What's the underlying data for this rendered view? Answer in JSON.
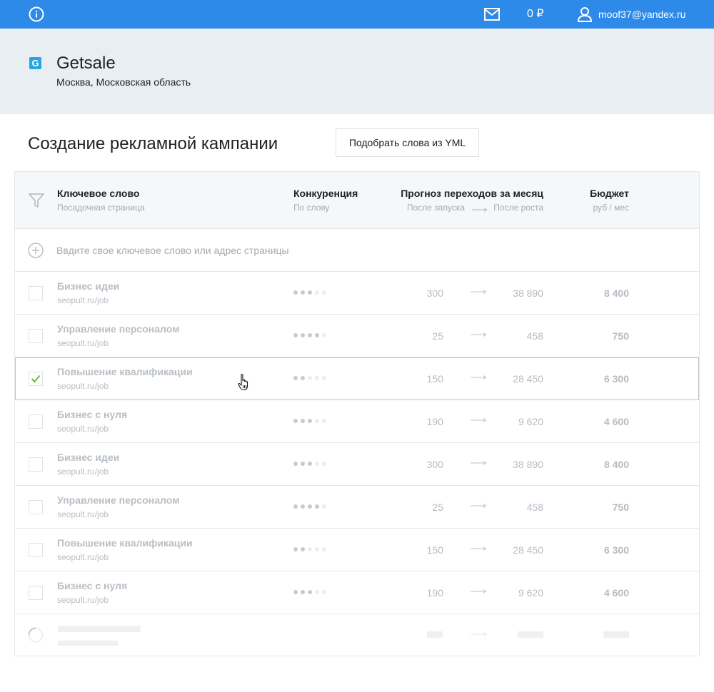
{
  "topbar": {
    "balance": "0 ₽",
    "email": "moof37@yandex.ru"
  },
  "company": {
    "logo_letter": "G",
    "name": "Getsale",
    "region": "Москва, Московская область"
  },
  "page": {
    "title": "Создание рекламной кампании",
    "yml_button": "Подобрать слова из YML"
  },
  "table": {
    "headers": {
      "keyword": "Ключевое слово",
      "keyword_sub": "Посадочная страница",
      "competition": "Конкуренция",
      "competition_sub": "По слову",
      "forecast": "Прогноз переходов за месяц",
      "forecast_start": "После запуска",
      "forecast_grow": "После роста",
      "budget": "Бюджет",
      "budget_sub": "руб / мес"
    },
    "add_placeholder": "Ввдите свое ключевое слово или адрес страницы",
    "rows": [
      {
        "keyword": "Бизнес идеи",
        "url": "seopult.ru/job",
        "competition": 3,
        "start": "300",
        "grow": "38 890",
        "budget": "8 400",
        "checked": false
      },
      {
        "keyword": "Управление персоналом",
        "url": "seopult.ru/job",
        "competition": 4,
        "start": "25",
        "grow": "458",
        "budget": "750",
        "checked": false
      },
      {
        "keyword": "Повышение квалификации",
        "url": "seopult.ru/job",
        "competition": 2,
        "start": "150",
        "grow": "28 450",
        "budget": "6 300",
        "checked": true
      },
      {
        "keyword": "Бизнес с нуля",
        "url": "seopult.ru/job",
        "competition": 3,
        "start": "190",
        "grow": "9 620",
        "budget": "4 600",
        "checked": false
      },
      {
        "keyword": "Бизнес идеи",
        "url": "seopult.ru/job",
        "competition": 3,
        "start": "300",
        "grow": "38 890",
        "budget": "8 400",
        "checked": false
      },
      {
        "keyword": "Управление персоналом",
        "url": "seopult.ru/job",
        "competition": 4,
        "start": "25",
        "grow": "458",
        "budget": "750",
        "checked": false
      },
      {
        "keyword": "Повышение квалификации",
        "url": "seopult.ru/job",
        "competition": 2,
        "start": "150",
        "grow": "28 450",
        "budget": "6 300",
        "checked": false
      },
      {
        "keyword": "Бизнес с нуля",
        "url": "seopult.ru/job",
        "competition": 3,
        "start": "190",
        "grow": "9 620",
        "budget": "4 600",
        "checked": false
      }
    ]
  },
  "colors": {
    "topbar": "#2d8ae8",
    "header_bg": "#e9eef2",
    "check": "#5cc23a"
  },
  "icons": [
    "info-icon",
    "mail-icon",
    "user-icon",
    "filter-icon",
    "plus-circle-icon",
    "arrow-right-icon",
    "check-icon",
    "loading-spinner-icon",
    "hand-cursor-icon"
  ]
}
